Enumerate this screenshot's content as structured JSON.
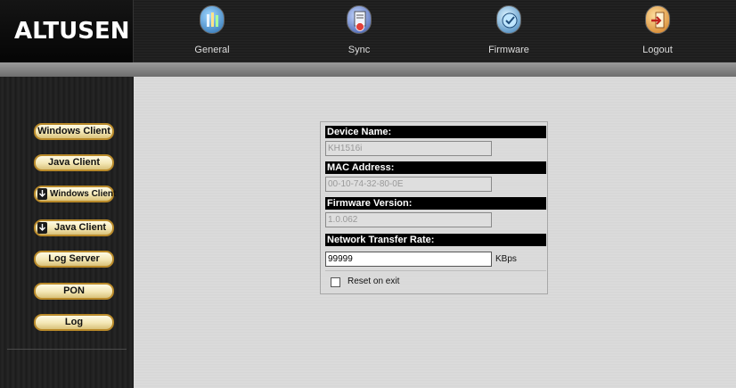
{
  "header": {
    "logo_text": "ALTUSEN",
    "nav": [
      {
        "label": "General",
        "icon": "general-icon"
      },
      {
        "label": "Sync",
        "icon": "sync-icon"
      },
      {
        "label": "Firmware",
        "icon": "firmware-icon"
      },
      {
        "label": "Logout",
        "icon": "logout-icon"
      }
    ]
  },
  "sidebar": {
    "buttons": [
      {
        "label": "Windows Client"
      },
      {
        "label": "Java Client"
      },
      {
        "label": "Windows Client",
        "icon": "download-icon"
      },
      {
        "label": "Java Client",
        "icon": "download-icon"
      },
      {
        "label": "Log Server"
      },
      {
        "label": "PON"
      },
      {
        "label": "Log"
      }
    ]
  },
  "form": {
    "device_name": {
      "label": "Device Name:",
      "value": "KH1516i"
    },
    "mac_address": {
      "label": "MAC Address:",
      "value": "00-10-74-32-80-0E"
    },
    "firmware_version": {
      "label": "Firmware Version:",
      "value": "1.0.062"
    },
    "transfer_rate": {
      "label": "Network Transfer Rate:",
      "value": "99999",
      "unit": "KBps"
    },
    "reset_on_exit": {
      "label": "Reset on exit",
      "checked": false
    }
  },
  "colors": {
    "header_bg": "#0d0d0d",
    "button_fill": "#f3e6b3",
    "button_border": "#b98a2a",
    "field_header_bg": "#000000"
  }
}
